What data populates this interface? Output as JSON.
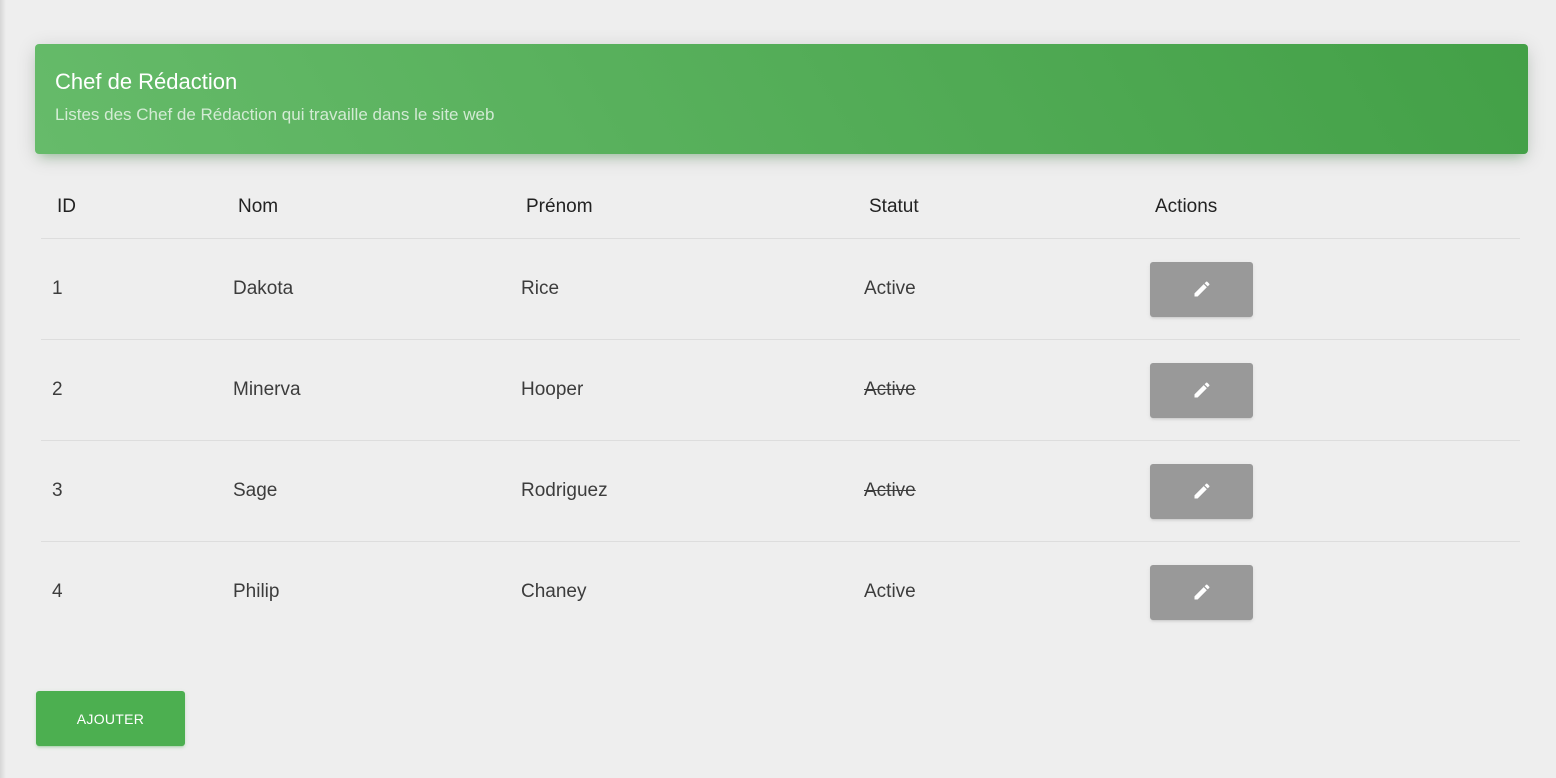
{
  "header": {
    "title": "Chef de Rédaction",
    "subtitle": "Listes des Chef de Rédaction qui travaille dans le site web",
    "gradient": [
      "#66bb6a",
      "#43a047"
    ]
  },
  "table": {
    "columns": [
      "ID",
      "Nom",
      "Prénom",
      "Statut",
      "Actions"
    ],
    "rows": [
      {
        "id": "1",
        "nom": "Dakota",
        "prenom": "Rice",
        "statut": "Active",
        "statut_struck": false,
        "action_icon": "pencil-icon"
      },
      {
        "id": "2",
        "nom": "Minerva",
        "prenom": "Hooper",
        "statut": "Active",
        "statut_struck": true,
        "action_icon": "pencil-icon"
      },
      {
        "id": "3",
        "nom": "Sage",
        "prenom": "Rodriguez",
        "statut": "Active",
        "statut_struck": true,
        "action_icon": "pencil-icon"
      },
      {
        "id": "4",
        "nom": "Philip",
        "prenom": "Chaney",
        "statut": "Active",
        "statut_struck": false,
        "action_icon": "pencil-icon"
      }
    ]
  },
  "footer": {
    "add_label": "AJOUTER"
  },
  "colors": {
    "accent": "#4caf50",
    "edit_button": "#999999",
    "background": "#eeeeee"
  }
}
